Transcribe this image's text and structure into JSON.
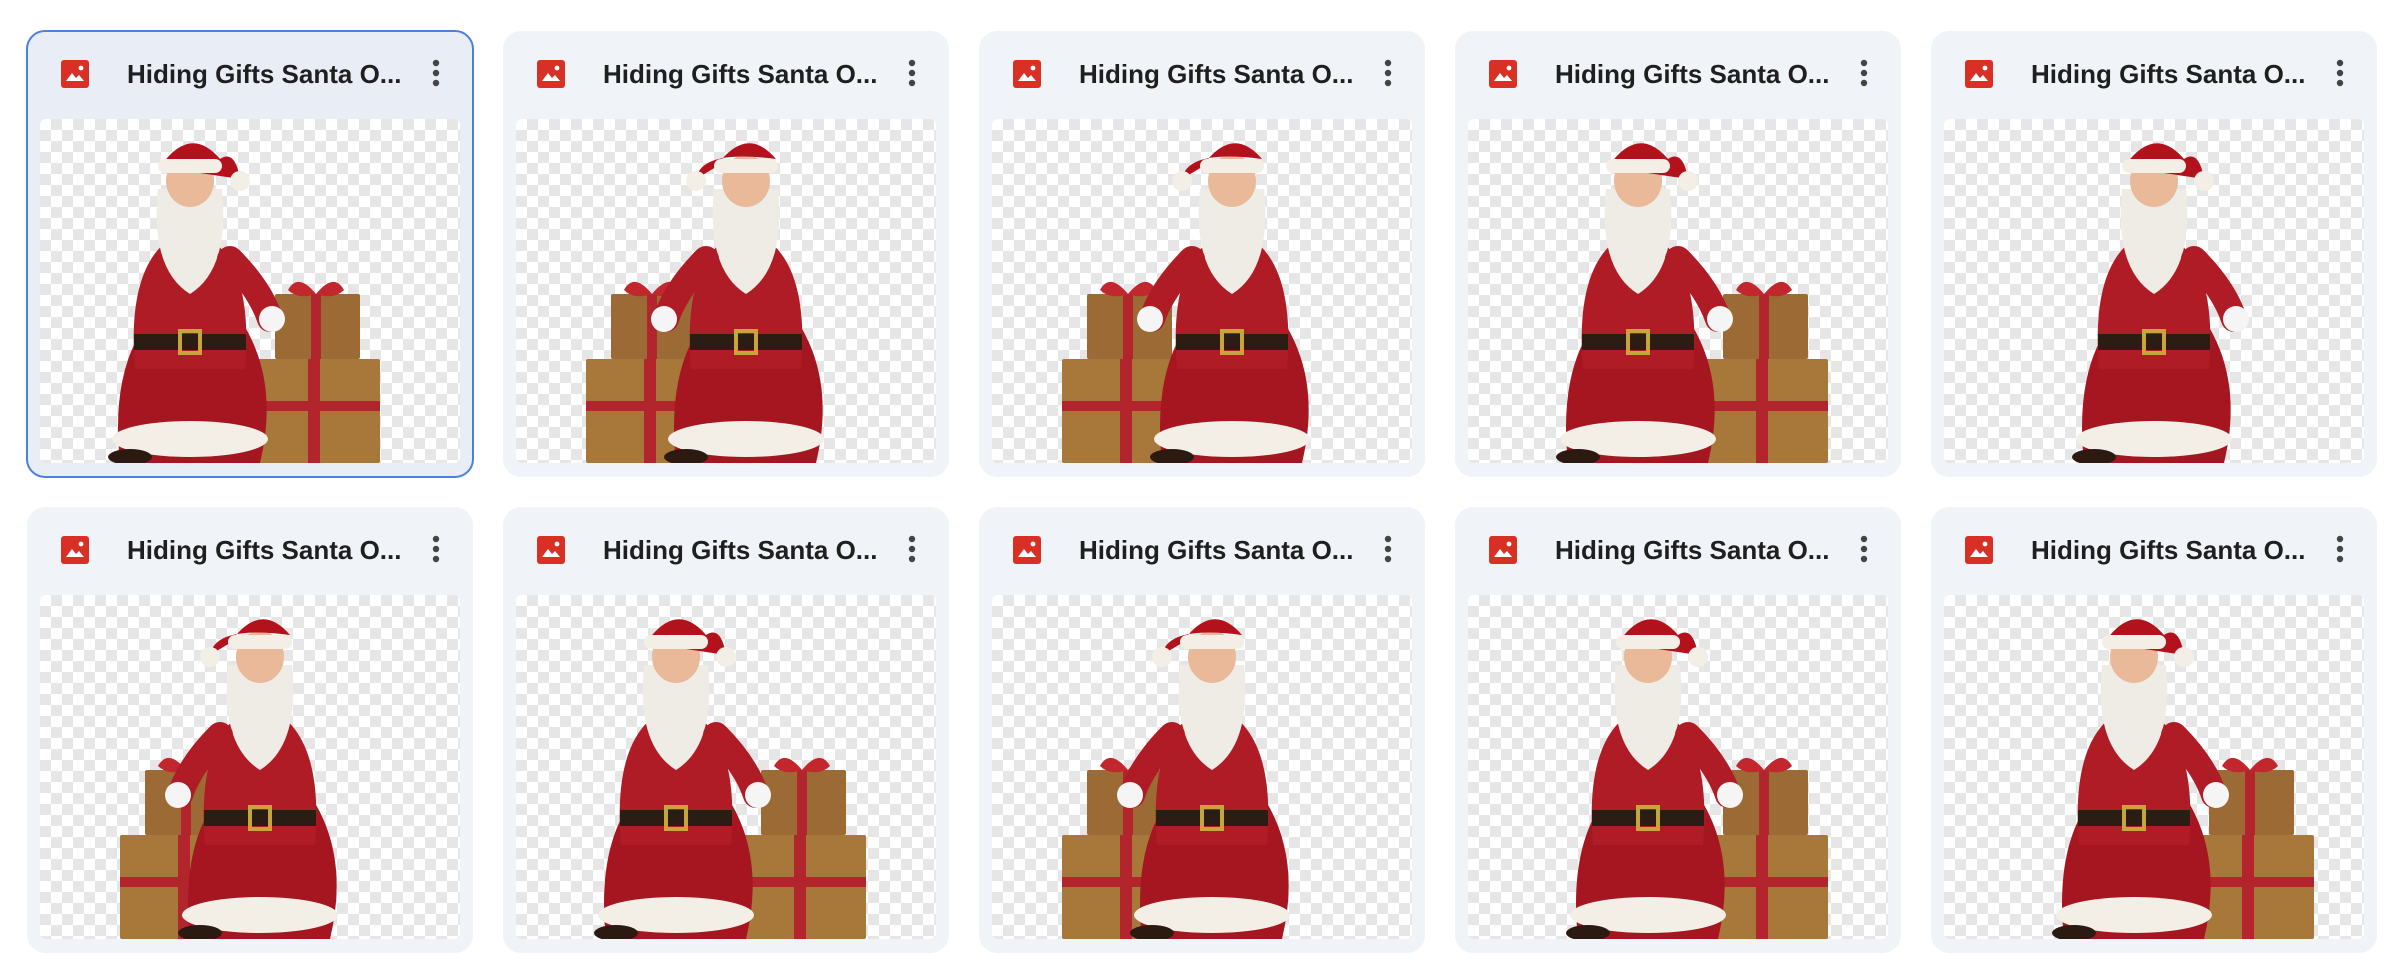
{
  "files": [
    {
      "title": "Hiding Gifts Santa O...",
      "selected": true,
      "variant": 0
    },
    {
      "title": "Hiding Gifts Santa O...",
      "selected": false,
      "variant": 1
    },
    {
      "title": "Hiding Gifts Santa O...",
      "selected": false,
      "variant": 2
    },
    {
      "title": "Hiding Gifts Santa O...",
      "selected": false,
      "variant": 3
    },
    {
      "title": "Hiding Gifts Santa O...",
      "selected": false,
      "variant": 4
    },
    {
      "title": "Hiding Gifts Santa O...",
      "selected": false,
      "variant": 5
    },
    {
      "title": "Hiding Gifts Santa O...",
      "selected": false,
      "variant": 6
    },
    {
      "title": "Hiding Gifts Santa O...",
      "selected": false,
      "variant": 7
    },
    {
      "title": "Hiding Gifts Santa O...",
      "selected": false,
      "variant": 8
    },
    {
      "title": "Hiding Gifts Santa O...",
      "selected": false,
      "variant": 9
    }
  ],
  "icons": {
    "file_type": "image-file-icon",
    "more": "more-vertical-icon"
  },
  "colors": {
    "card_bg": "#f0f4f9",
    "selected_outline": "#4b7fe0",
    "image_icon_red": "#d93025",
    "title_text": "#1f1f1f"
  }
}
